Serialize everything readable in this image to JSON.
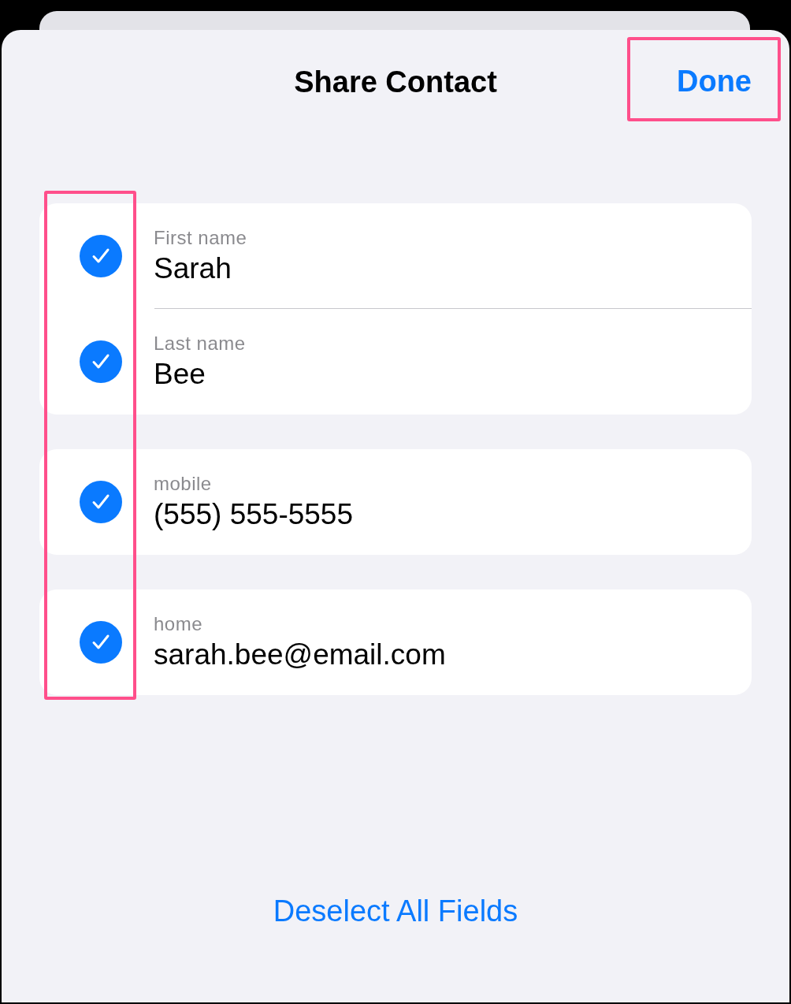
{
  "header": {
    "title": "Share Contact",
    "done": "Done",
    "done_highlighted": true
  },
  "checks_highlighted": true,
  "groups": [
    {
      "fields": [
        {
          "label": "First name",
          "value": "Sarah",
          "checked": true
        },
        {
          "label": "Last name",
          "value": "Bee",
          "checked": true
        }
      ]
    },
    {
      "fields": [
        {
          "label": "mobile",
          "value": "(555) 555-5555",
          "checked": true
        }
      ]
    },
    {
      "fields": [
        {
          "label": "home",
          "value": "sarah.bee@email.com",
          "checked": true
        }
      ]
    }
  ],
  "footer": {
    "action": "Deselect All Fields"
  }
}
